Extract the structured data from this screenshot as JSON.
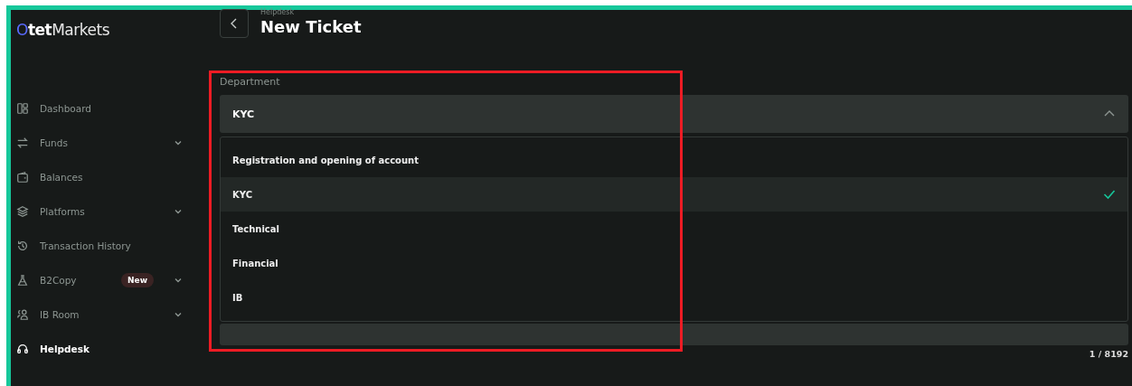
{
  "logo": {
    "brand": "Otet",
    "suffix": "Markets"
  },
  "sidebar": {
    "items": [
      {
        "label": "Dashboard",
        "expandable": false,
        "selected": false
      },
      {
        "label": "Funds",
        "expandable": true,
        "selected": false
      },
      {
        "label": "Balances",
        "expandable": false,
        "selected": false
      },
      {
        "label": "Platforms",
        "expandable": true,
        "selected": false
      },
      {
        "label": "Transaction History",
        "expandable": false,
        "selected": false
      },
      {
        "label": "B2Copy",
        "expandable": true,
        "selected": false,
        "badge": "New"
      },
      {
        "label": "IB Room",
        "expandable": true,
        "selected": false
      },
      {
        "label": "Helpdesk",
        "expandable": false,
        "selected": true
      }
    ]
  },
  "header": {
    "breadcrumb": "Helpdesk",
    "title": "New Ticket"
  },
  "department": {
    "label": "Department",
    "value": "KYC",
    "expanded": true,
    "options": [
      {
        "label": "Registration and opening of account",
        "selected": false
      },
      {
        "label": "KYC",
        "selected": true
      },
      {
        "label": "Technical",
        "selected": false
      },
      {
        "label": "Financial",
        "selected": false
      },
      {
        "label": "IB",
        "selected": false
      }
    ]
  },
  "message": {
    "counter": "1 / 8192"
  },
  "annotation": {
    "kind": "highlight"
  }
}
